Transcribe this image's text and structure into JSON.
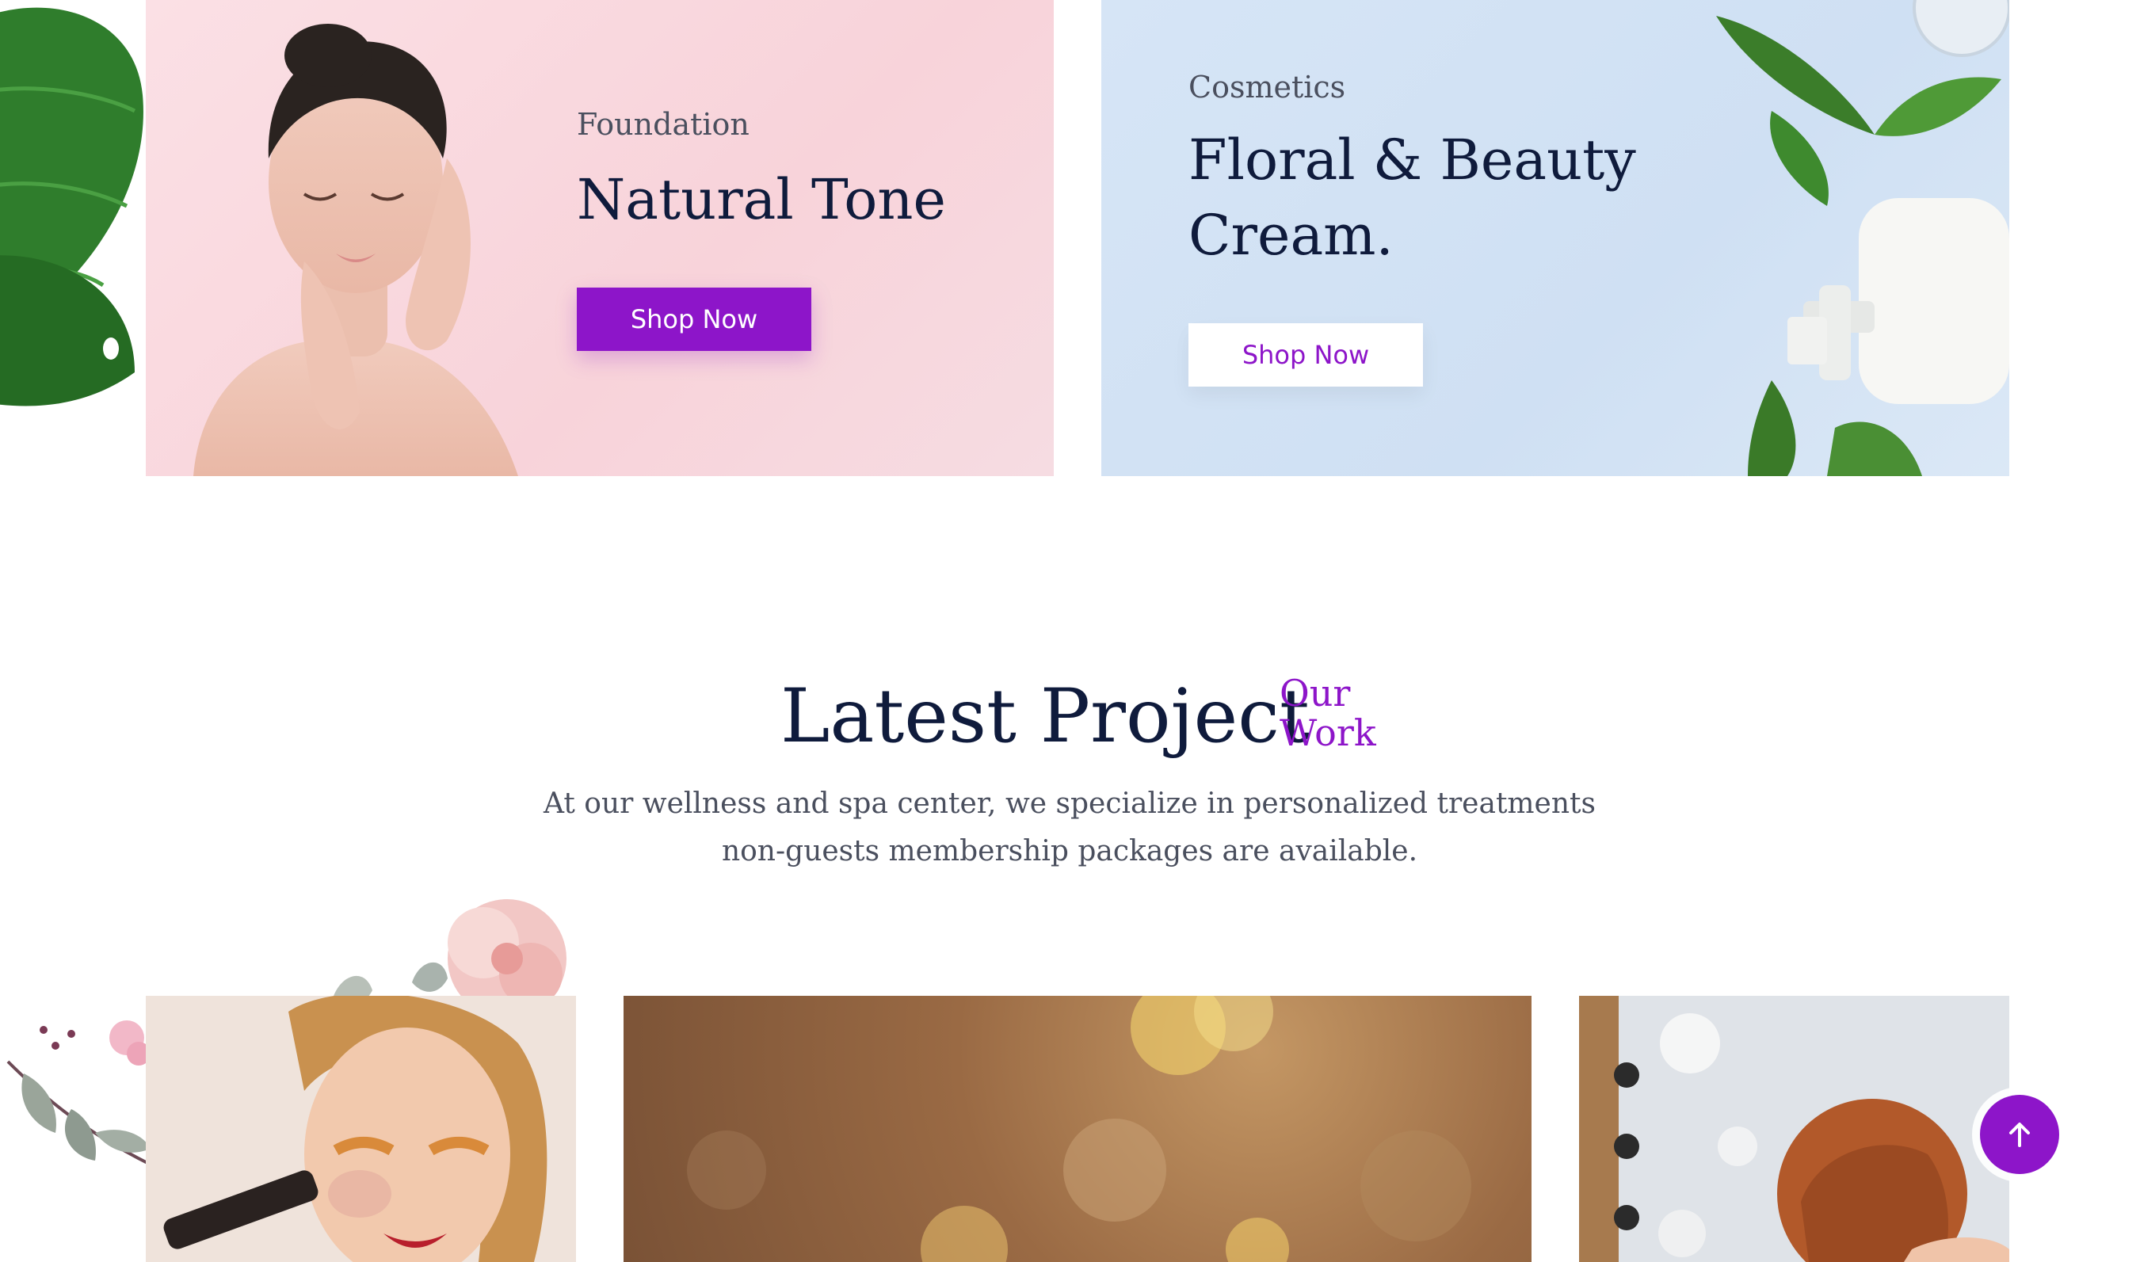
{
  "banners": [
    {
      "subtitle": "Foundation",
      "title_line1": "Natural Tone",
      "title_line2": "",
      "button_label": "Shop Now"
    },
    {
      "subtitle": "Cosmetics",
      "title_line1": "Floral & Beauty",
      "title_line2": "Cream.",
      "button_label": "Shop Now"
    }
  ],
  "section": {
    "title": "Latest Project",
    "tag_line1": "Our",
    "tag_line2": "Work",
    "desc_line1": "At our wellness and spa center, we specialize in personalized treatments",
    "desc_line2": "non-guests membership packages are available."
  },
  "colors": {
    "accent": "#8d15c9",
    "heading": "#0f1b3c",
    "body_text": "#4a4f5e",
    "banner_pink": "#f8d3da",
    "banner_blue": "#cfe0f3"
  },
  "icons": {
    "scroll_top": "arrow-up-icon"
  }
}
